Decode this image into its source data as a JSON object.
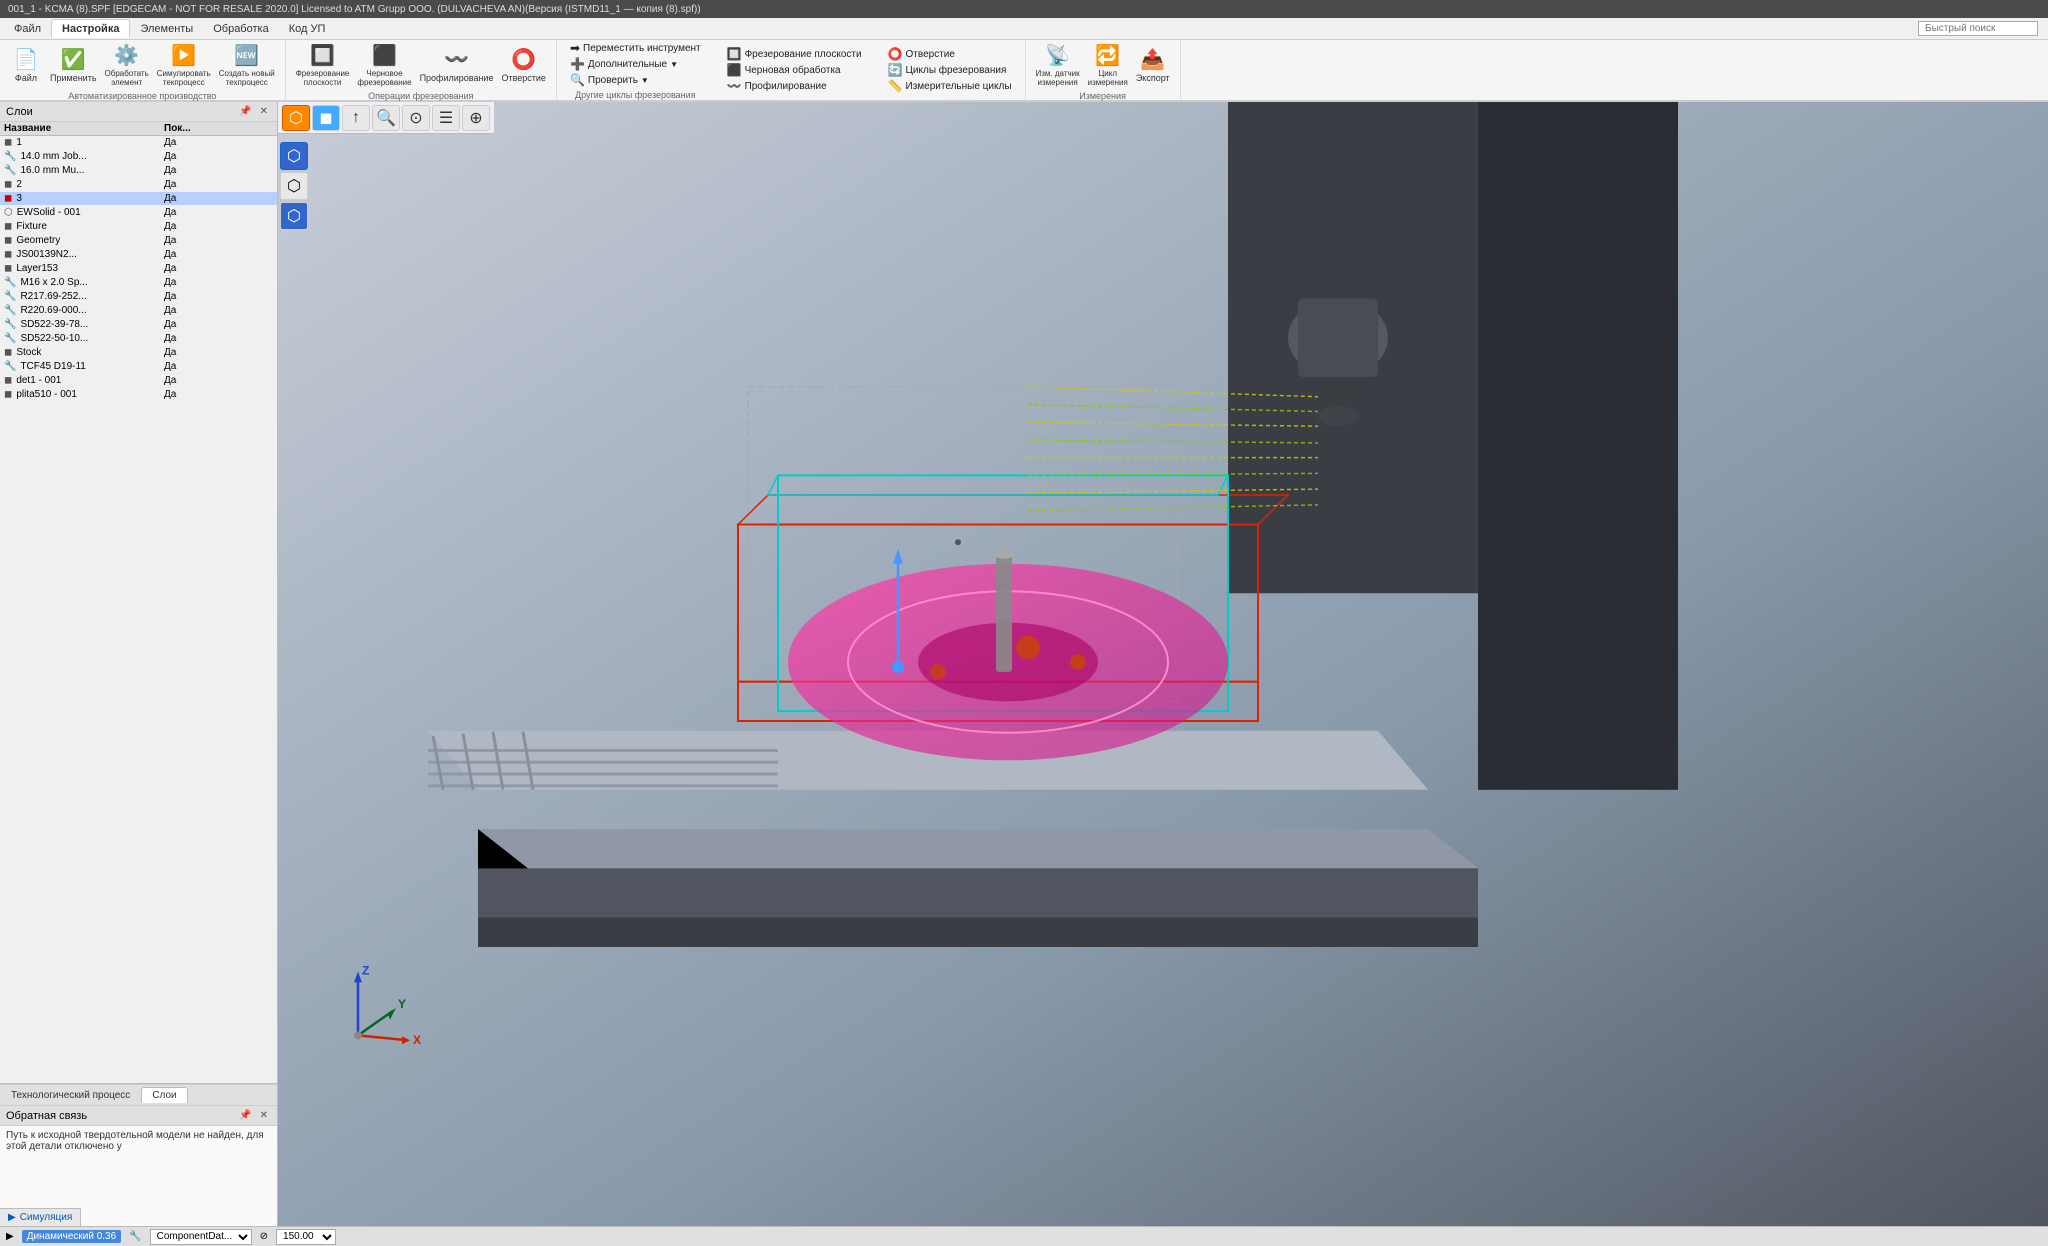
{
  "titlebar": {
    "text": "001_1 - KCMA (8).SPF [EDGECAM - NOT FOR RESALE 2020.0] Licensed to ATM Grupp OOO. (DULVACHEVA AN)(Версия (ISTMD11_1 — копия (8).spf))"
  },
  "ribbon": {
    "tabs": [
      "Файл",
      "Настройка",
      "Элементы",
      "Обработка",
      "Код УП"
    ],
    "active_tab": "Настройка",
    "search_placeholder": "Быстрый поиск",
    "groups": [
      {
        "label": "Автоматизированное производство",
        "buttons": [
          "Файл",
          "Применить",
          "Обработать элемент",
          "Симулировать текпроцесс",
          "Создать новый техпроцесс"
        ]
      },
      {
        "label": "Операции фрезерования",
        "buttons": [
          "Фрезерование плоскости",
          "Черновое фрезерование",
          "Профилирование",
          "Отверстие"
        ]
      },
      {
        "label": "Другие циклы фрезерования",
        "buttons": [
          "Переместить инструмент",
          "Дополнительные",
          "Проверить",
          "Фрезерование плоскости",
          "Черновая обработка",
          "Профилирование",
          "Отверстие",
          "Циклы фрезерования",
          "Измерительные циклы"
        ]
      },
      {
        "label": "Измерения",
        "buttons": [
          "Изм. датчик измерения",
          "Цикл измерения",
          "Экспорт"
        ]
      }
    ]
  },
  "layers_panel": {
    "title": "Слои",
    "columns": [
      "Название",
      "Пок..."
    ],
    "rows": [
      {
        "name": "1",
        "visible": "Да",
        "icon": "layer",
        "color": "default"
      },
      {
        "name": "14.0 mm Job...",
        "visible": "Да",
        "icon": "tool",
        "color": "default"
      },
      {
        "name": "16.0 mm Mu...",
        "visible": "Да",
        "icon": "tool",
        "color": "default"
      },
      {
        "name": "2",
        "visible": "Да",
        "icon": "layer",
        "color": "default"
      },
      {
        "name": "3",
        "visible": "Да",
        "icon": "layer",
        "color": "red",
        "selected": true
      },
      {
        "name": "EWSolid - 001",
        "visible": "Да",
        "icon": "solid",
        "color": "default"
      },
      {
        "name": "Fixture",
        "visible": "Да",
        "icon": "layer",
        "color": "default"
      },
      {
        "name": "Geometry",
        "visible": "Да",
        "icon": "layer",
        "color": "default"
      },
      {
        "name": "JS00139N2...",
        "visible": "Да",
        "icon": "layer",
        "color": "default"
      },
      {
        "name": "Layer153",
        "visible": "Да",
        "icon": "layer",
        "color": "default"
      },
      {
        "name": "M16 x 2.0 Sp...",
        "visible": "Да",
        "icon": "tool",
        "color": "default"
      },
      {
        "name": "R217.69-252...",
        "visible": "Да",
        "icon": "tool",
        "color": "default"
      },
      {
        "name": "R220.69-000...",
        "visible": "Да",
        "icon": "tool",
        "color": "default"
      },
      {
        "name": "SD522-39-78...",
        "visible": "Да",
        "icon": "tool",
        "color": "default"
      },
      {
        "name": "SD522-50-10...",
        "visible": "Да",
        "icon": "tool",
        "color": "default"
      },
      {
        "name": "Stock",
        "visible": "Да",
        "icon": "layer",
        "color": "default"
      },
      {
        "name": "TCF45 D19-11",
        "visible": "Да",
        "icon": "tool",
        "color": "default"
      },
      {
        "name": "det1 - 001",
        "visible": "Да",
        "icon": "layer",
        "color": "default"
      },
      {
        "name": "plita510 - 001",
        "visible": "Да",
        "icon": "layer",
        "color": "default"
      }
    ]
  },
  "panel_tabs": [
    {
      "label": "Технологический процесс",
      "active": false
    },
    {
      "label": "Слои",
      "active": true
    }
  ],
  "feedback_panel": {
    "title": "Обратная связь",
    "content": "Путь к исходной твердотельной модели не найден, для этой детали отключено у"
  },
  "viewport_toolbar": {
    "buttons": [
      "⬡",
      "⬡",
      "↑",
      "🔍",
      "⊙",
      "☰",
      "⊕"
    ]
  },
  "side_toolbar": {
    "buttons": [
      "⬡",
      "⬡",
      "⬡"
    ]
  },
  "statusbar": {
    "dynamic_label": "Динамический 0.36",
    "component_label": "ComponentDat...",
    "zoom_value": "150.00",
    "simulation_btn": "Симуляция",
    "icons": [
      "▶",
      "🔧"
    ]
  },
  "coord_axes": {
    "x_color": "#cc2200",
    "y_color": "#006600",
    "z_color": "#0044cc"
  }
}
